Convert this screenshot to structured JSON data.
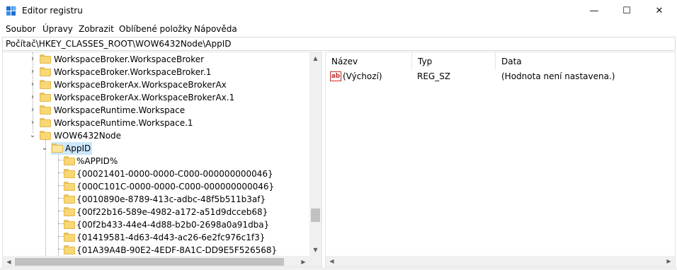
{
  "window": {
    "title": "Editor registru",
    "icon": "regedit-icon",
    "controls": {
      "minimize": "—",
      "maximize": "☐",
      "close": "✕"
    }
  },
  "menu": {
    "items": [
      "Soubor",
      "Úpravy",
      "Zobrazit",
      "Oblíbené položky",
      "Nápověda"
    ]
  },
  "address": {
    "path": "Počítač\\HKEY_CLASSES_ROOT\\WOW6432Node\\AppID"
  },
  "tree": {
    "items": [
      {
        "label": "WorkspaceBroker.WorkspaceBroker",
        "expander": "›"
      },
      {
        "label": "WorkspaceBroker.WorkspaceBroker.1",
        "expander": "›"
      },
      {
        "label": "WorkspaceBrokerAx.WorkspaceBrokerAx",
        "expander": "›"
      },
      {
        "label": "WorkspaceBrokerAx.WorkspaceBrokerAx.1",
        "expander": "›"
      },
      {
        "label": "WorkspaceRuntime.Workspace",
        "expander": "›"
      },
      {
        "label": "WorkspaceRuntime.Workspace.1",
        "expander": "›"
      },
      {
        "label": "WOW6432Node",
        "expander": "⌄"
      },
      {
        "label": "AppID",
        "expander": "⌄",
        "selected": true
      },
      {
        "label": "%APPID%"
      },
      {
        "label": "{00021401-0000-0000-C000-000000000046}"
      },
      {
        "label": "{000C101C-0000-0000-C000-000000000046}"
      },
      {
        "label": "{0010890e-8789-413c-adbc-48f5b511b3af}"
      },
      {
        "label": "{00f22b16-589e-4982-a172-a51d9dcceb68}"
      },
      {
        "label": "{00f2b433-44e4-4d88-b2b0-2698a0a91dba}"
      },
      {
        "label": "{01419581-4d63-4d43-ac26-6e2fc976c1f3}"
      },
      {
        "label": "{01A39A4B-90E2-4EDF-8A1C-DD9E5F526568}"
      }
    ]
  },
  "values": {
    "columns": [
      "Název",
      "Typ",
      "Data"
    ],
    "rows": [
      {
        "name": "(Výchozí)",
        "type": "REG_SZ",
        "data": "(Hodnota není nastavena.)",
        "icon": "string-value-icon",
        "icon_text": "ab"
      }
    ]
  },
  "scroll": {
    "up": "▲",
    "down": "▼",
    "left": "◀",
    "right": "▶"
  }
}
